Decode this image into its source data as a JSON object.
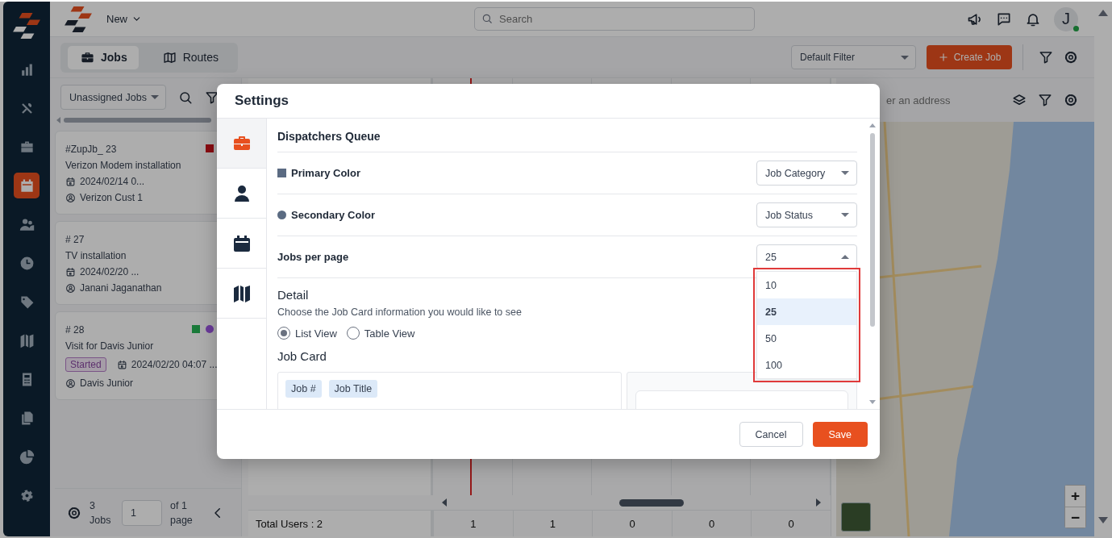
{
  "sidebar": {
    "items": [
      {
        "selected": false
      },
      {
        "selected": false
      },
      {
        "selected": false
      },
      {
        "selected": true
      },
      {
        "selected": false
      },
      {
        "selected": false
      },
      {
        "selected": false
      },
      {
        "selected": false
      },
      {
        "selected": false
      },
      {
        "selected": false
      },
      {
        "selected": false
      },
      {
        "selected": false
      }
    ]
  },
  "topbar": {
    "new_menu": "New",
    "search": {
      "placeholder": "Search"
    },
    "avatar": {
      "initial": "J",
      "online": true
    }
  },
  "toolbar": {
    "tabs": [
      {
        "label": "Jobs",
        "selected": true
      },
      {
        "label": "Routes",
        "selected": false
      }
    ],
    "filter": "Default Filter",
    "create_button": "Create Job"
  },
  "job_list": {
    "filter": "Unassigned Jobs",
    "jobs": [
      {
        "number": "#ZupJb_ 23",
        "title": "Verizon Modem installation",
        "date": "2024/02/14 0...",
        "customer": "Verizon Cust 1",
        "markers": [
          {
            "kind": "square",
            "color": "#8a0c12"
          }
        ]
      },
      {
        "number": "# 27",
        "title": "TV installation",
        "date": "2024/02/20 ...",
        "customer": "Janani Jaganathan"
      },
      {
        "number": "# 28",
        "title": "Visit for Davis Junior",
        "status": "Started",
        "date": "2024/02/20 04:07 ...",
        "customer": "Davis Junior",
        "markers": [
          {
            "kind": "square",
            "color": "#1a7a3a"
          },
          {
            "kind": "circle",
            "color": "#6a3a9a"
          }
        ]
      }
    ],
    "footer": {
      "count": "3",
      "count_label": "Jobs",
      "page": "1",
      "of": "of 1",
      "page_label": "page"
    }
  },
  "board": {
    "total_users": "Total Users : 2",
    "counts": [
      "1",
      "1",
      "0",
      "0",
      "0"
    ]
  },
  "map": {
    "search_placeholder": "er an address",
    "zoom_in": "+",
    "zoom_out": "−"
  },
  "modal": {
    "title": "Settings",
    "tabs": [
      {
        "selected": true
      },
      {
        "selected": false
      },
      {
        "selected": false
      },
      {
        "selected": false
      }
    ],
    "section_title": "Dispatchers Queue",
    "rows": [
      {
        "label": "Primary Color",
        "kind": "square",
        "value": "Job Category",
        "expanded": false
      },
      {
        "label": "Secondary Color",
        "kind": "circle",
        "value": "Job Status",
        "expanded": false
      },
      {
        "label": "Jobs per page",
        "kind": "plain",
        "value": "25",
        "expanded": true,
        "highlighted": true,
        "options": [
          {
            "label": "10",
            "selected": false
          },
          {
            "label": "25",
            "selected": true
          },
          {
            "label": "50",
            "selected": false
          },
          {
            "label": "100",
            "selected": false
          }
        ]
      }
    ],
    "details_title": "Detail",
    "description": "Choose the Job Card information you would like to see",
    "views": [
      {
        "label": "List View",
        "selected": true
      },
      {
        "label": "Table View",
        "selected": false
      }
    ],
    "job_card_title": "Job Card",
    "card_fields": [
      "Job #",
      "Job Title"
    ],
    "cancel": "Cancel",
    "save": "Save"
  }
}
